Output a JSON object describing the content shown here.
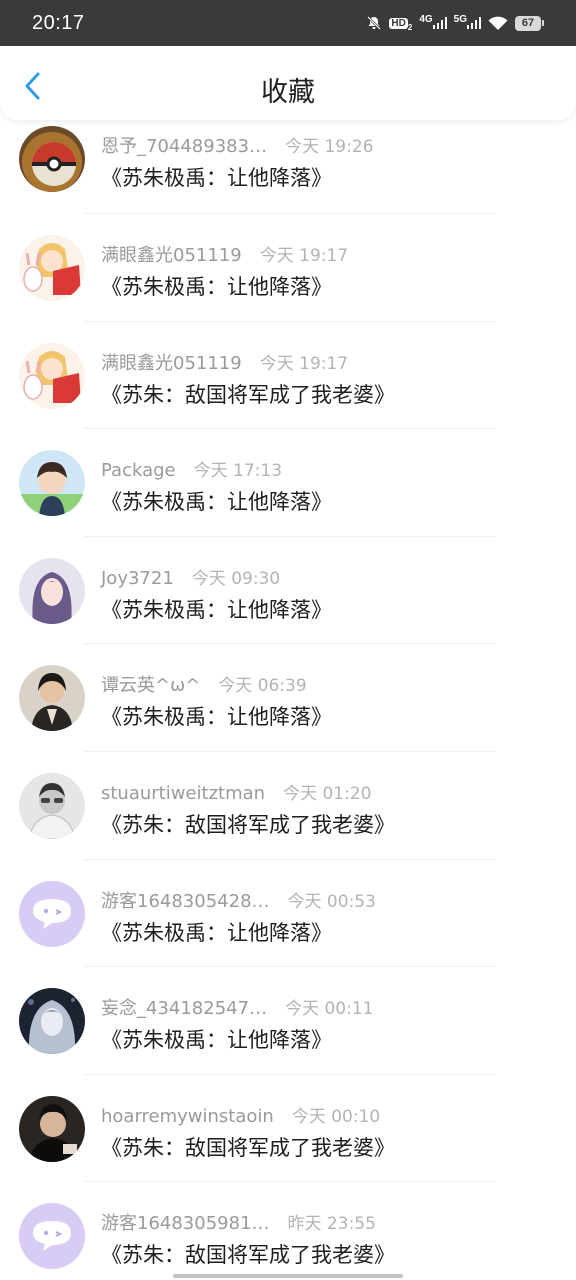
{
  "status_bar": {
    "time": "20:17",
    "hd_label": "HD",
    "net1": "4G",
    "net2": "5G",
    "battery": "67"
  },
  "header": {
    "title": "收藏",
    "back_icon": "chevron-left-icon",
    "accent_color": "#2f9be8"
  },
  "items": [
    {
      "name": "恩予_704489383…",
      "time": "今天  19:26",
      "title": "《苏朱极禹：让他降落》",
      "avatar": "pokeball"
    },
    {
      "name": "满眼鑫光051119",
      "time": "今天  19:17",
      "title": "《苏朱极禹：让他降落》",
      "avatar": "anime-girl"
    },
    {
      "name": "满眼鑫光051119",
      "time": "今天  19:17",
      "title": "《苏朱：敌国将军成了我老婆》",
      "avatar": "anime-girl"
    },
    {
      "name": "Package",
      "time": "今天  17:13",
      "title": "《苏朱极禹：让他降落》",
      "avatar": "boy-green"
    },
    {
      "name": "Joy3721",
      "time": "今天  09:30",
      "title": "《苏朱极禹：让他降落》",
      "avatar": "girl-purple"
    },
    {
      "name": "谭云英^ω^",
      "time": "今天  06:39",
      "title": "《苏朱极禹：让他降落》",
      "avatar": "girl-dark"
    },
    {
      "name": "stuaurtiweitztman",
      "time": "今天  01:20",
      "title": "《苏朱：敌国将军成了我老婆》",
      "avatar": "man-gray"
    },
    {
      "name": "游客1648305428…",
      "time": "今天  00:53",
      "title": "《苏朱极禹：让他降落》",
      "avatar": "default-chat"
    },
    {
      "name": "妄念_434182547…",
      "time": "今天  00:11",
      "title": "《苏朱极禹：让他降落》",
      "avatar": "dark-art"
    },
    {
      "name": "hoarremywinstaoin",
      "time": "今天  00:10",
      "title": "《苏朱：敌国将军成了我老婆》",
      "avatar": "man-photo"
    },
    {
      "name": "游客1648305981…",
      "time": "昨天  23:55",
      "title": "《苏朱：敌国将军成了我老婆》",
      "avatar": "default-chat"
    }
  ]
}
